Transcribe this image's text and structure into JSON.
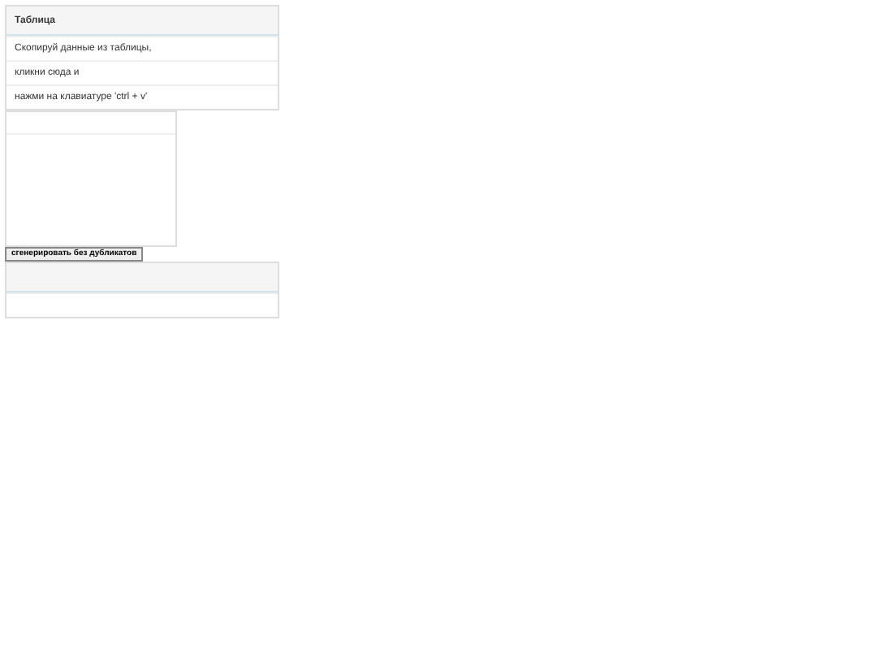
{
  "panel": {
    "title": "Таблица",
    "rows": [
      "Скопируй данные из таблицы,",
      "кликни сюда и",
      "нажми на клавиатуре 'ctrl + v'"
    ]
  },
  "button": {
    "label": "сгенерировать без дубликатов"
  }
}
